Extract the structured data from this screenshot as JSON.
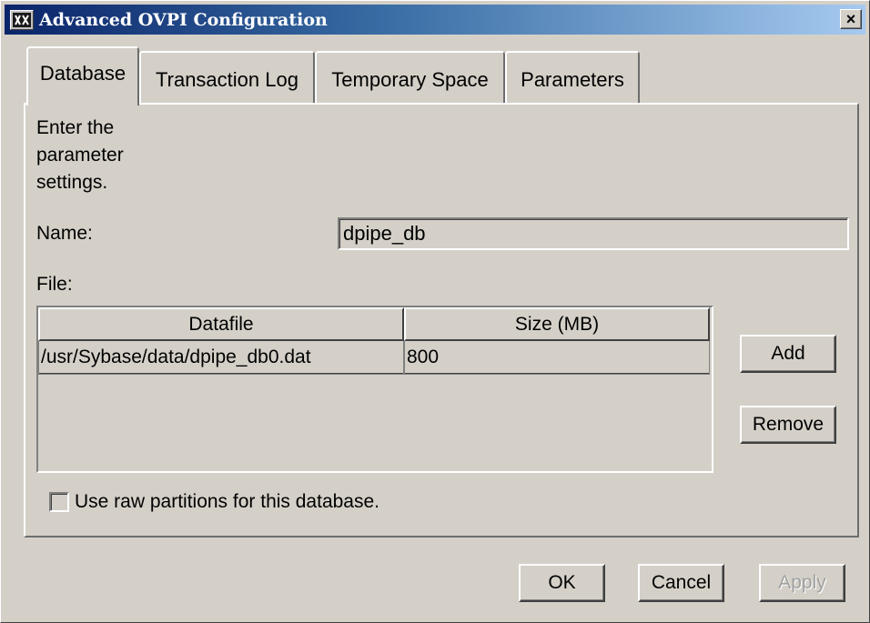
{
  "window": {
    "title": "Advanced OVPI Configuration",
    "close_glyph": "×"
  },
  "tabs": [
    {
      "label": "Database",
      "active": true
    },
    {
      "label": "Transaction Log",
      "active": false
    },
    {
      "label": "Temporary Space",
      "active": false
    },
    {
      "label": "Parameters",
      "active": false
    }
  ],
  "panel": {
    "instructions": [
      "Enter the",
      "parameter",
      "settings."
    ],
    "name_label": "Name:",
    "name_value": "dpipe_db",
    "file_label": "File:",
    "table": {
      "columns": [
        "Datafile",
        "Size (MB)"
      ],
      "rows": [
        {
          "datafile": "/usr/Sybase/data/dpipe_db0.dat",
          "size": "800"
        }
      ]
    },
    "add_label": "Add",
    "remove_label": "Remove",
    "raw_partitions_label": "Use raw partitions for this database.",
    "raw_partitions_checked": false
  },
  "footer": {
    "ok_label": "OK",
    "cancel_label": "Cancel",
    "apply_label": "Apply",
    "apply_enabled": false
  },
  "colors": {
    "face": "#d4d0c8",
    "titlebar_start": "#0a246a",
    "titlebar_end": "#a6caf0"
  }
}
